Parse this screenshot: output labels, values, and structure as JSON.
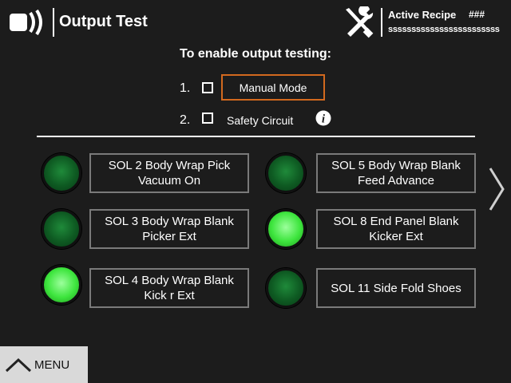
{
  "header": {
    "title": "Output Test",
    "app_icon": "signal-broadcast-icon",
    "tools_icon": "wrench-screwdriver-icon",
    "recipe_label": "Active Recipe",
    "recipe_id": "###",
    "recipe_name": "ssssssssssssssssssssssss"
  },
  "enable": {
    "heading": "To enable output testing:",
    "steps": [
      {
        "number": "1.",
        "label": "Manual Mode",
        "checked": false
      },
      {
        "number": "2.",
        "label": "Safety Circuit",
        "checked": false
      }
    ],
    "info_icon": "info-icon"
  },
  "outputs": [
    {
      "label": "SOL 2 Body Wrap Pick Vacuum On",
      "on": false
    },
    {
      "label": "SOL 3 Body Wrap Blank Picker Ext",
      "on": false
    },
    {
      "label": "SOL 4 Body Wrap Blank Kick  r Ext",
      "on": true
    },
    {
      "label": "SOL 5 Body Wrap Blank Feed Advance",
      "on": false
    },
    {
      "label": "SOL 8 End Panel Blank Kicker Ext",
      "on": true
    },
    {
      "label": "SOL 11 Side Fold Shoes",
      "on": false
    }
  ],
  "nav": {
    "next_icon": "chevron-right-icon",
    "menu_label": "MENU",
    "menu_icon": "chevron-up-icon"
  },
  "colors": {
    "background": "#1c1c1c",
    "highlight_border": "#d2691e",
    "lamp_on": "#3de53d",
    "lamp_off": "#0e5a22"
  }
}
